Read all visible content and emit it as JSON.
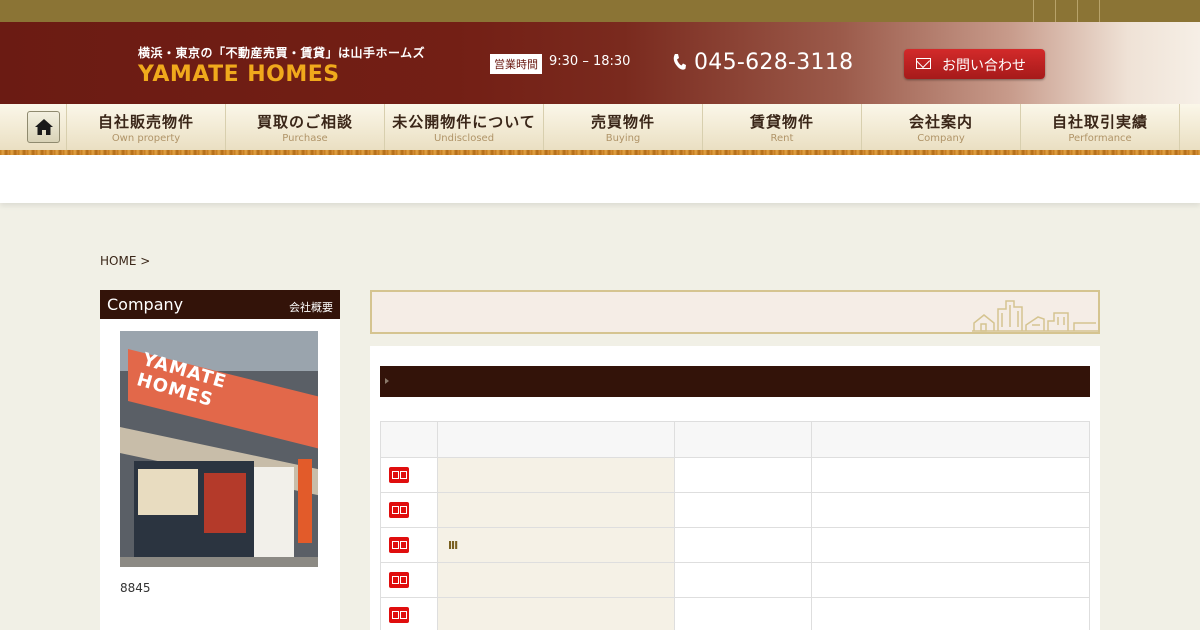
{
  "header": {
    "tagline": "横浜・東京の「不動産売買・賃貸」は山手ホームズ",
    "logo": "YAMATE HOMES",
    "hours_label": "営業時間",
    "hours_time": "9:30 – 18:30",
    "phone": "045-628-3118",
    "contact_label": "お問い合わせ"
  },
  "nav": {
    "items": [
      {
        "jp": "自社販売物件",
        "en": "Own property"
      },
      {
        "jp": "買取のご相談",
        "en": "Purchase"
      },
      {
        "jp": "未公開物件について",
        "en": "Undisclosed"
      },
      {
        "jp": "売買物件",
        "en": "Buying"
      },
      {
        "jp": "賃貸物件",
        "en": "Rent"
      },
      {
        "jp": "会社案内",
        "en": "Company"
      },
      {
        "jp": "自社取引実績",
        "en": "Performance"
      }
    ]
  },
  "breadcrumb": "HOME >",
  "sidebar": {
    "title_en": "Company",
    "title_jp": "会社概要",
    "storefront_sign": "YAMATE HOMES",
    "code": "8845"
  },
  "table": {
    "row3_mark": "III"
  },
  "colors": {
    "brand_red": "#6b1b13",
    "logo_orange": "#f0a91c",
    "dark_header": "#331309",
    "badge_red": "#e00e0e"
  }
}
